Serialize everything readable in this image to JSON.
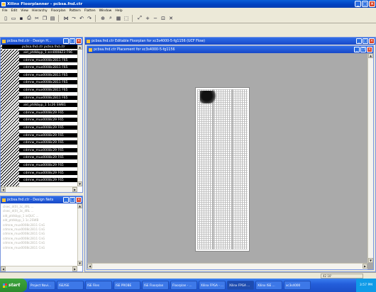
{
  "app": {
    "title": "Xilinx Floorplanner - pcbsa.fnd.ctr"
  },
  "menubar": [
    "File",
    "Edit",
    "View",
    "Hierarchy",
    "Floorplan",
    "Pattern",
    "Flatten",
    "Window",
    "Help"
  ],
  "toolbar_icons": [
    "new-icon",
    "open-icon",
    "save-icon",
    "print-icon",
    "cut-icon",
    "copy-icon",
    "paste-icon",
    "sep",
    "rats-icon",
    "flightline-icon",
    "undo-icon",
    "redo-icon",
    "sep",
    "zoom-icon",
    "search-icon",
    "grid-icon",
    "select-icon",
    "sep",
    "zoom-full-icon",
    "zoom-in-icon",
    "zoom-out-icon",
    "fit-icon",
    "delete-icon"
  ],
  "left_top": {
    "title": "pcbsa.fnd.ctr - Design H...",
    "header": "pcbsa.fnd.ctr  pcbsa.fnd.ctr",
    "rows": [
      "ald_ptdkbyp_1 zcn0008Z3 F96",
      "cdmrw_mux0008c2811 F65",
      "cdmrw_mux0008c2811 F65",
      "cdmrw_mux0008c2811 F65",
      "cdmrw_mux0008c2811 F65",
      "cdmrw_mux0008c2811 F65",
      "cdmrw_mux0008c2811 F65",
      "ald_ptdkbyp_1 1c26 SWB1",
      "cdmrw_mux0008c29 F65",
      "cdmrw_mux0008c29 F65",
      "cdmrw_mux0008c29 F65",
      "cdmrw_mux0008c29 F65",
      "cdmrw_mux0008c29 F65",
      "cdmrw_mux0008c29 F65",
      "cdmrw_mux0008c29 F65",
      "cdmrw_mux0008c29 F65",
      "cdmrw_mux0008c29 F65",
      "cdmrw_mux0008c29 F65"
    ]
  },
  "left_bottom": {
    "title": "pcbsa.fnd.ctr - Design Nets",
    "rows": [
      "clsec_d(0)_3c_4RL ...",
      "clsec_d(0)_3c_4RL ...",
      "ald_ptdkbyp_1 ioQLIC ...",
      "ald_ptdkbyp_1 1c.2SWB",
      "cdmrw_mux0008c2811 CnG",
      "cdmrw_mux0008c2811 CnG",
      "cdmrw_mux0008c2811 CnG",
      "cdmrw_mux0008c2811 CnG",
      "cdmrw_mux0008c2811 CnG",
      "cdmrw_mux0008c2811 CnG"
    ]
  },
  "main_window": {
    "title": "pcbsa.fnd.ctr Editable Floorplan for xc3s4000-5-fg1156 (UCF Flow)"
  },
  "inner_window": {
    "title": "pcbsa.fnd.ctr Placement for xc3s4000-5-fg1156"
  },
  "status": {
    "coords": "42 10'"
  },
  "taskbar": {
    "start_label": "start",
    "tasks": [
      "Project Navi...",
      "ISE/ISE",
      "ISE Files",
      "ISE PROBE",
      "ISE Floorplan",
      "Floorplan - ...",
      "Xilinx FPGA - ...",
      "Xilinx FPGA ...",
      "Xilinx ISE ...",
      "xc3s4000"
    ],
    "clock": "3:57 PM"
  }
}
